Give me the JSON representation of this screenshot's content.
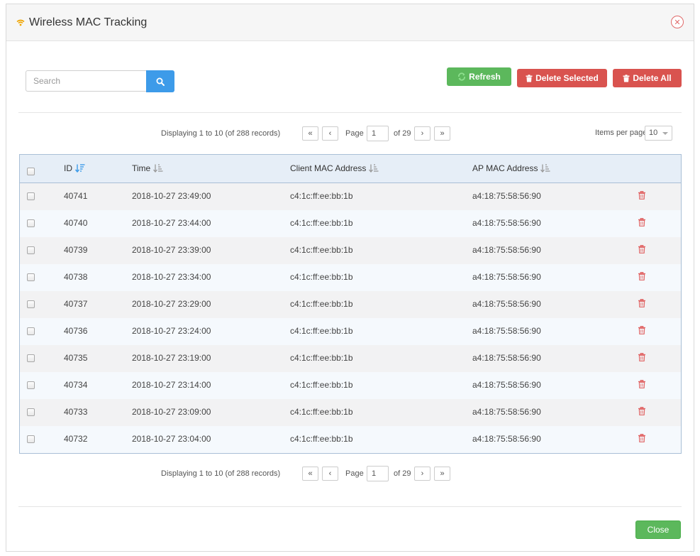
{
  "dialog": {
    "title": "Wireless MAC Tracking",
    "close_icon": "close-circle-icon",
    "title_icon": "wifi-icon"
  },
  "toolbar": {
    "search_placeholder": "Search",
    "search_value": "",
    "refresh_label": "Refresh",
    "delete_selected_label": "Delete Selected",
    "delete_all_label": "Delete All"
  },
  "pagination": {
    "display_text": "Displaying 1 to 10 (of 288 records)",
    "page_label": "Page",
    "current_page": "1",
    "of_label": "of 29",
    "first": "«",
    "prev": "‹",
    "next": "›",
    "last": "»",
    "items_per_page_label": "Items per page",
    "items_per_page_value": "10"
  },
  "table": {
    "columns": [
      "ID",
      "Time",
      "Client MAC Address",
      "AP MAC Address"
    ],
    "rows": [
      {
        "id": "40741",
        "time": "2018-10-27 23:49:00",
        "client": "c4:1c:ff:ee:bb:1b",
        "ap": "a4:18:75:58:56:90"
      },
      {
        "id": "40740",
        "time": "2018-10-27 23:44:00",
        "client": "c4:1c:ff:ee:bb:1b",
        "ap": "a4:18:75:58:56:90"
      },
      {
        "id": "40739",
        "time": "2018-10-27 23:39:00",
        "client": "c4:1c:ff:ee:bb:1b",
        "ap": "a4:18:75:58:56:90"
      },
      {
        "id": "40738",
        "time": "2018-10-27 23:34:00",
        "client": "c4:1c:ff:ee:bb:1b",
        "ap": "a4:18:75:58:56:90"
      },
      {
        "id": "40737",
        "time": "2018-10-27 23:29:00",
        "client": "c4:1c:ff:ee:bb:1b",
        "ap": "a4:18:75:58:56:90"
      },
      {
        "id": "40736",
        "time": "2018-10-27 23:24:00",
        "client": "c4:1c:ff:ee:bb:1b",
        "ap": "a4:18:75:58:56:90"
      },
      {
        "id": "40735",
        "time": "2018-10-27 23:19:00",
        "client": "c4:1c:ff:ee:bb:1b",
        "ap": "a4:18:75:58:56:90"
      },
      {
        "id": "40734",
        "time": "2018-10-27 23:14:00",
        "client": "c4:1c:ff:ee:bb:1b",
        "ap": "a4:18:75:58:56:90"
      },
      {
        "id": "40733",
        "time": "2018-10-27 23:09:00",
        "client": "c4:1c:ff:ee:bb:1b",
        "ap": "a4:18:75:58:56:90"
      },
      {
        "id": "40732",
        "time": "2018-10-27 23:04:00",
        "client": "c4:1c:ff:ee:bb:1b",
        "ap": "a4:18:75:58:56:90"
      }
    ]
  },
  "footer": {
    "close_label": "Close"
  },
  "colors": {
    "accent_blue": "#3d9be9",
    "success_green": "#5cb85c",
    "danger_red": "#d9534f",
    "wifi_orange": "#f0a500",
    "header_bg": "#e6eef7"
  }
}
